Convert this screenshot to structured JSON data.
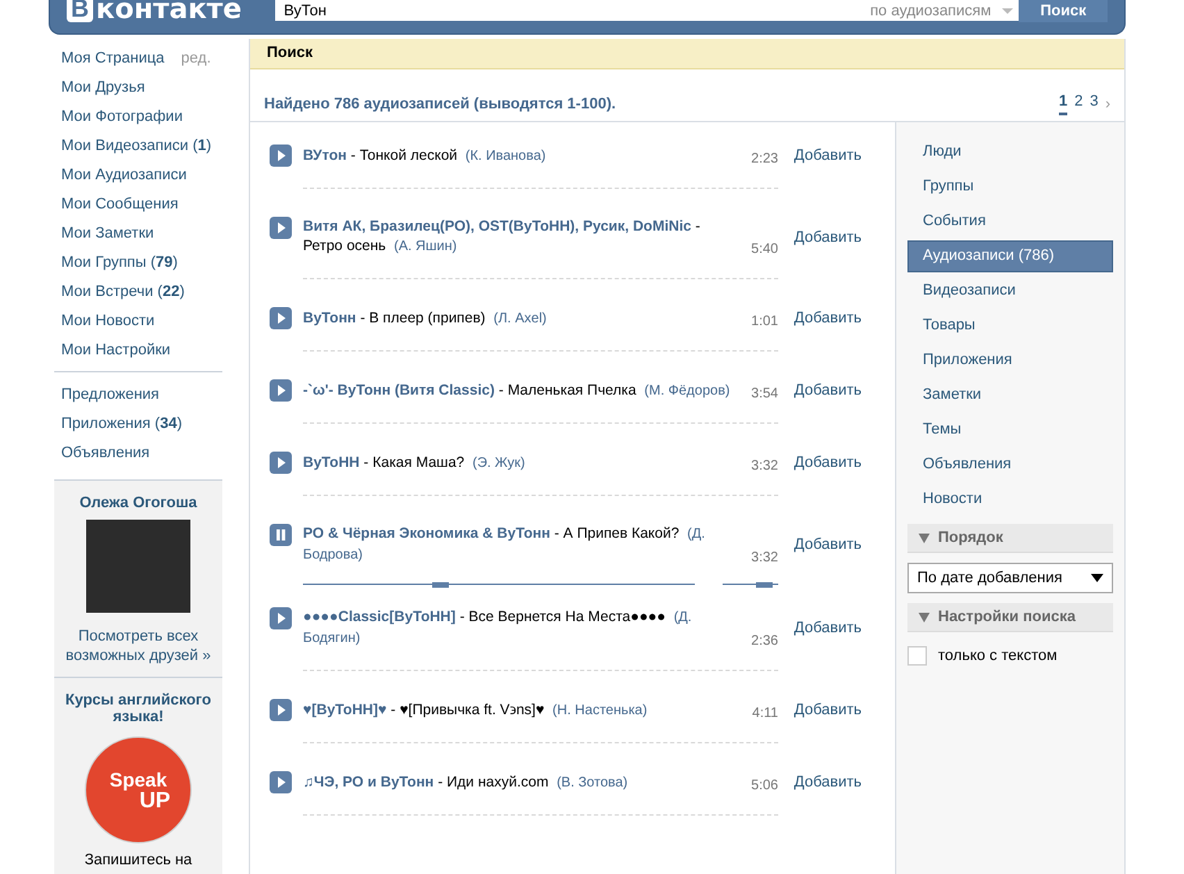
{
  "header": {
    "logo": {
      "letter": "В",
      "text": "контакте"
    },
    "search": {
      "value": "ВуТон"
    },
    "scope": "по аудиозаписям",
    "button": "Поиск"
  },
  "sidebar": {
    "menu": [
      {
        "label": "Моя Страница",
        "extra": "ред."
      },
      {
        "label": "Мои Друзья"
      },
      {
        "label": "Мои Фотографии"
      },
      {
        "label": "Мои Видеозаписи (**1**)"
      },
      {
        "label": "Мои Аудиозаписи"
      },
      {
        "label": "Мои Сообщения"
      },
      {
        "label": "Мои Заметки"
      },
      {
        "label": "Мои Группы (**79**)"
      },
      {
        "label": "Мои Встречи (**22**)"
      },
      {
        "label": "Мои Новости"
      },
      {
        "label": "Мои Настройки"
      }
    ],
    "menu_2": [
      {
        "label": "Предложения"
      },
      {
        "label": "Приложения (**34**)"
      },
      {
        "label": "Объявления"
      }
    ],
    "friend_suggestion": {
      "name": "Олежа Огогоша",
      "link": "Посмотреть всех возможных друзей »"
    },
    "ad": {
      "title": "Курсы английского языка!",
      "logo_text": [
        "Speak",
        "UP"
      ],
      "text": "Запишитесь на"
    }
  },
  "main": {
    "title": "Поиск",
    "summary": "Найдено 786 аудиозаписей (выводятся 1-100).",
    "pages": [
      {
        "label": "1",
        "selected": true
      },
      {
        "label": "2",
        "selected": false
      },
      {
        "label": "3",
        "selected": false
      }
    ],
    "next": "›",
    "separator": "-",
    "tracks": [
      {
        "artist": "ВУтон",
        "title": "Тонкой леской",
        "uploader": "(К. Иванова)",
        "duration": "2:23",
        "add": "Добавить",
        "playing": false
      },
      {
        "artist": "Витя АК, Бразилец(РО), OST(ВуТоНН), Русик, DoMiNic",
        "title": "Ретро осень",
        "uploader": "(А. Яшин)",
        "duration": "5:40",
        "add": "Добавить",
        "playing": false
      },
      {
        "artist": "ВуТонн",
        "title": "В плеер (припев)",
        "uploader": "(Л. Axel)",
        "duration": "1:01",
        "add": "Добавить",
        "playing": false
      },
      {
        "artist": "-`ω'- ВуТонн (Витя Classic)",
        "title": "Маленькая Пчелка",
        "uploader": "(М. Фёдоров)",
        "duration": "3:54",
        "add": "Добавить",
        "playing": false
      },
      {
        "artist": "ВуТоНН",
        "title": "Какая Маша?",
        "uploader": "(Э. Жук)",
        "duration": "3:32",
        "add": "Добавить",
        "playing": false
      },
      {
        "artist": "РО & Чёрная Экономика & ВуТонн",
        "title": "А Припев Какой?",
        "uploader": "(Д. Бодрова)",
        "duration": "3:32",
        "add": "Добавить",
        "playing": true,
        "progress": {
          "level": 0.35
        },
        "volume": {
          "level": 0.75
        }
      },
      {
        "artist": "●●●●Classic[ВуТоНН]",
        "title": "Все Вернется На Места●●●●",
        "uploader": "(Д. Бодягин)",
        "duration": "2:36",
        "add": "Добавить",
        "playing": false
      },
      {
        "artist": "♥[ВуТоНН]♥",
        "title": "♥[Привычка ft. V϶ns]♥",
        "uploader": "(Н. Настенька)",
        "duration": "4:11",
        "add": "Добавить",
        "playing": false
      },
      {
        "artist": "♫ЧЭ, РО и ВуТонн",
        "title": "Иди нахуй.com",
        "uploader": "(В. Зотова)",
        "duration": "5:06",
        "add": "Добавить",
        "playing": false
      }
    ]
  },
  "filters": {
    "categories": [
      {
        "label": "Люди",
        "selected": false
      },
      {
        "label": "Группы",
        "selected": false
      },
      {
        "label": "События",
        "selected": false
      },
      {
        "label": "Аудиозаписи (786)",
        "selected": true
      },
      {
        "label": "Видеозаписи",
        "selected": false
      },
      {
        "label": "Товары",
        "selected": false
      },
      {
        "label": "Приложения",
        "selected": false
      },
      {
        "label": "Заметки",
        "selected": false
      },
      {
        "label": "Темы",
        "selected": false
      },
      {
        "label": "Объявления",
        "selected": false
      },
      {
        "label": "Новости",
        "selected": false
      }
    ],
    "order": {
      "heading": "Порядок",
      "value": "По дате добавления"
    },
    "settings": {
      "heading": "Настройки поиска",
      "options": [
        {
          "label": "только с текстом",
          "checked": false
        }
      ]
    }
  }
}
